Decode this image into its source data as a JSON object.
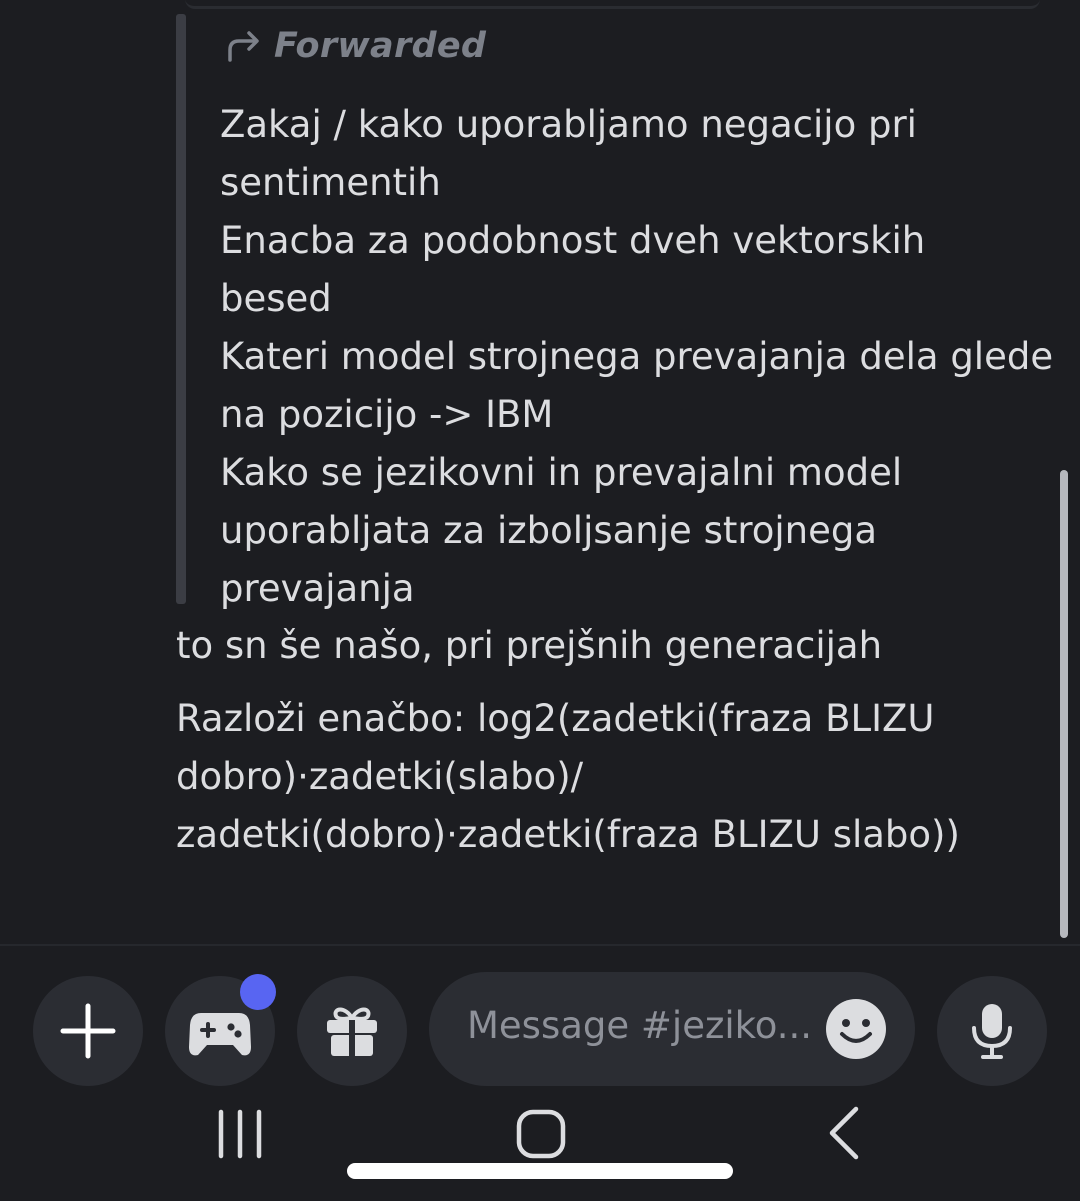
{
  "chat": {
    "forwarded": {
      "header_label": "Forwarded",
      "lines": [
        "Zakaj / kako uporabljamo negacijo pri",
        "sentimentih",
        "Enacba za podobnost dveh vektorskih",
        "besed",
        "Kateri model strojnega prevajanja dela glede",
        "na pozicijo -> IBM",
        "Kako se jezikovni in prevajalni model",
        "uporabljata za izboljsanje strojnega",
        "prevajanja"
      ]
    },
    "messages": [
      {
        "lines": [
          "to sn še našo, pri prejšnih generacijah"
        ]
      },
      {
        "lines": [
          "Razloži enačbo: log2(zadetki(fraza BLIZU",
          "dobro)·zadetki(slabo)/",
          "zadetki(dobro)·zadetki(fraza BLIZU slabo))"
        ]
      }
    ]
  },
  "composer": {
    "placeholder": "Message #jeziko...",
    "buttons": {
      "plus_icon": "plus-icon",
      "games_icon": "gamepad-icon",
      "gift_icon": "gift-icon",
      "emoji_icon": "emoji-icon",
      "mic_icon": "microphone-icon"
    },
    "accent_color": "#5865f2"
  },
  "navbar": {
    "recents_icon": "recents-icon",
    "home_icon": "home-icon",
    "back_icon": "back-icon"
  }
}
